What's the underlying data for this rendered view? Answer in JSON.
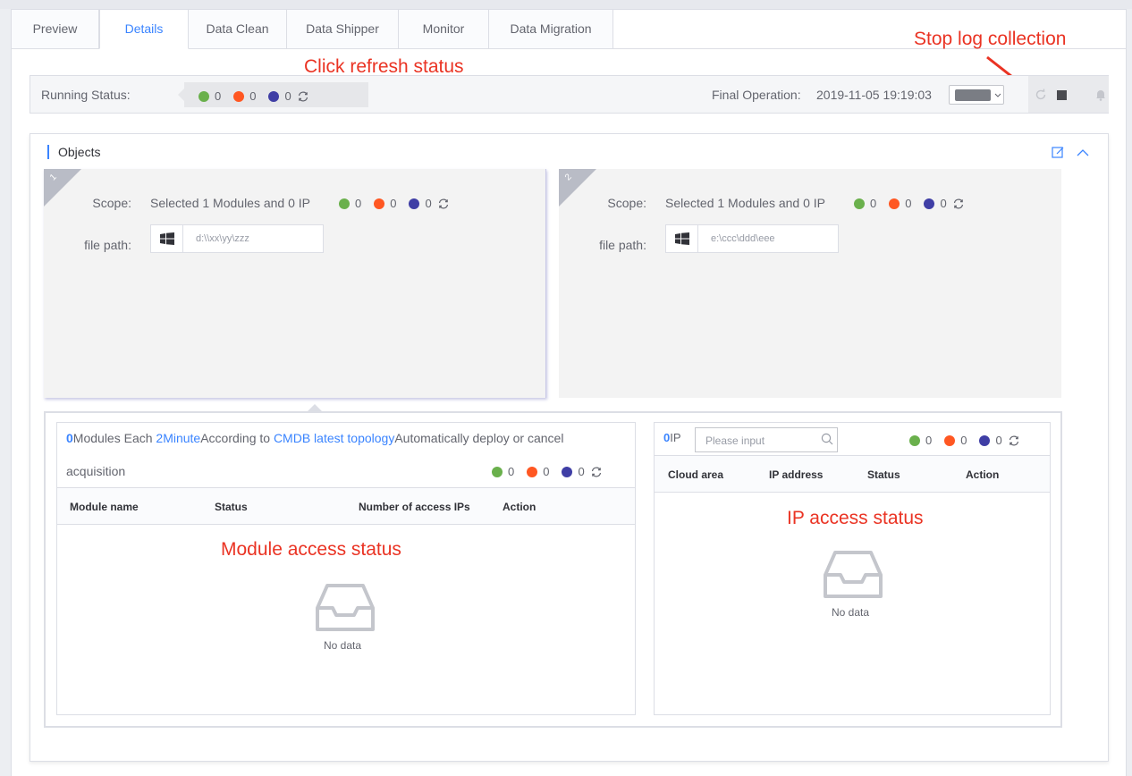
{
  "tabs": [
    "Preview",
    "Details",
    "Data Clean",
    "Data Shipper",
    "Monitor",
    "Data Migration"
  ],
  "running_status": {
    "label": "Running Status:",
    "green": "0",
    "orange": "0",
    "blue": "0",
    "final_label": "Final Operation:",
    "final_time": "2019-11-05 19:19:03"
  },
  "objects": {
    "title": "Objects",
    "cards": [
      {
        "num": "1",
        "scope_label": "Scope:",
        "scope_text": "Selected 1 Modules and 0 IP",
        "green": "0",
        "orange": "0",
        "blue": "0",
        "path_label": "file path:",
        "path": "d:\\\\xx\\yy\\zzz"
      },
      {
        "num": "2",
        "scope_label": "Scope:",
        "scope_text": "Selected 1 Modules and 0 IP",
        "green": "0",
        "orange": "0",
        "blue": "0",
        "path_label": "file path:",
        "path": "e:\\ccc\\ddd\\eee"
      }
    ]
  },
  "modules": {
    "count": "0",
    "line1_a": "Modules   Each ",
    "interval": "2Minute",
    "line1_b": "According to ",
    "topology": "CMDB latest topology",
    "line1_c": "Automatically deploy or cancel",
    "line2": "acquisition",
    "green": "0",
    "orange": "0",
    "blue": "0",
    "columns": [
      "Module name",
      "Status",
      "Number of access IPs",
      "Action"
    ],
    "empty": "No data"
  },
  "ips": {
    "count": "0",
    "unit": "IP",
    "placeholder": "Please input",
    "green": "0",
    "orange": "0",
    "blue": "0",
    "columns": [
      "Cloud area",
      "IP address",
      "Status",
      "Action"
    ],
    "empty": "No data"
  },
  "annotations": {
    "refresh": "Click refresh status",
    "stop": "Stop log collection",
    "module": "Module access status",
    "ip": "IP access status"
  },
  "colors": {
    "green": "#6ab04c",
    "orange": "#ff5722",
    "blue": "#3f3ea5",
    "accent": "#3a84ff",
    "annotation": "#ea3323"
  },
  "icons": [
    "refresh-icon",
    "stop-icon",
    "bell-icon",
    "edit-icon",
    "chevron-up-icon",
    "windows-icon",
    "search-icon",
    "inbox-icon"
  ]
}
